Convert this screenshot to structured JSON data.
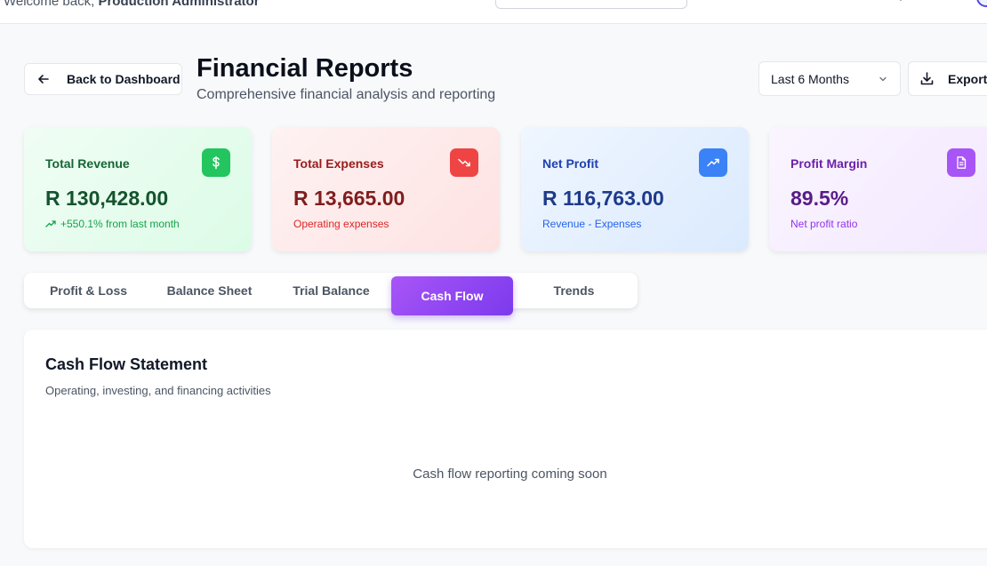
{
  "topbar": {
    "welcome_prefix": "Welcome back, ",
    "user_name": "Production Administrator"
  },
  "header": {
    "back_label": "Back to Dashboard",
    "title": "Financial Reports",
    "subtitle": "Comprehensive financial analysis and reporting",
    "period_selected": "Last 6 Months",
    "export_label": "Export"
  },
  "cards": {
    "revenue": {
      "label": "Total Revenue",
      "value": "R 130,428.00",
      "sub": "+550.1% from last month",
      "icon": "dollar-icon",
      "accent": "#22c55e"
    },
    "expenses": {
      "label": "Total Expenses",
      "value": "R 13,665.00",
      "sub": "Operating expenses",
      "icon": "trending-down-icon",
      "accent": "#ef4444"
    },
    "profit": {
      "label": "Net Profit",
      "value": "R 116,763.00",
      "sub": "Revenue - Expenses",
      "icon": "trending-up-icon",
      "accent": "#3b82f6"
    },
    "margin": {
      "label": "Profit Margin",
      "value": "89.5%",
      "sub": "Net profit ratio",
      "icon": "file-text-icon",
      "accent": "#a855f7"
    }
  },
  "tabs": [
    {
      "label": "Profit & Loss",
      "active": false
    },
    {
      "label": "Balance Sheet",
      "active": false
    },
    {
      "label": "Trial Balance",
      "active": false
    },
    {
      "label": "Cash Flow",
      "active": true
    },
    {
      "label": "Trends",
      "active": false
    }
  ],
  "panel": {
    "title": "Cash Flow Statement",
    "description": "Operating, investing, and financing activities",
    "empty_message": "Cash flow reporting coming soon"
  }
}
